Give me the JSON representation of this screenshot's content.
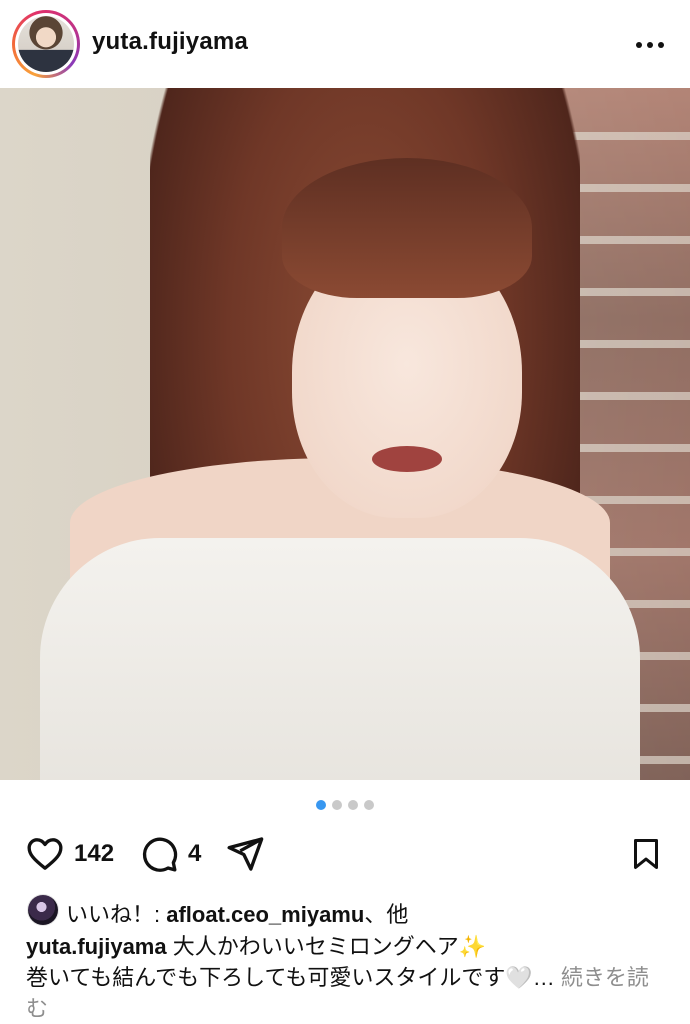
{
  "header": {
    "username": "yuta.fujiyama",
    "more_icon": "more-horizontal-icon"
  },
  "carousel": {
    "total": 4,
    "active_index": 0,
    "active_color": "#3897f0",
    "inactive_color": "#c9c9c9"
  },
  "actions": {
    "like_icon": "heart-icon",
    "like_count": "142",
    "comment_icon": "comment-icon",
    "comment_count": "4",
    "share_icon": "send-icon",
    "save_icon": "bookmark-icon"
  },
  "likes": {
    "label": "いいね！: ",
    "first_liker": "afloat.ceo_miyamu",
    "others": "、他"
  },
  "caption": {
    "username": "yuta.fujiyama",
    "line1": " 大人かわいいセミロングヘア✨",
    "line2": "巻いても結んでも下ろしても可愛いスタイルです🤍…",
    "more": " 続きを読む"
  }
}
